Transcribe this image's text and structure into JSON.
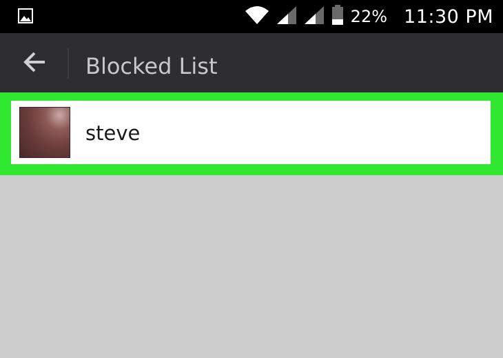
{
  "status_bar": {
    "battery_percent": "22%",
    "time": "11:30 PM",
    "icons": [
      "image-notification-icon",
      "wifi-icon",
      "signal-icon",
      "signal-icon",
      "battery-icon"
    ]
  },
  "action_bar": {
    "title": "Blocked List",
    "back_icon": "back-arrow-icon"
  },
  "blocked_list": {
    "items": [
      {
        "name": "steve",
        "avatar": "avatar"
      }
    ]
  },
  "colors": {
    "status_bar_bg": "#000000",
    "action_bar_bg": "#2e2e30",
    "title_text": "#c9c9c9",
    "highlight": "#2fe82f",
    "list_bg": "#ffffff",
    "page_bg": "#cdcdcd"
  }
}
